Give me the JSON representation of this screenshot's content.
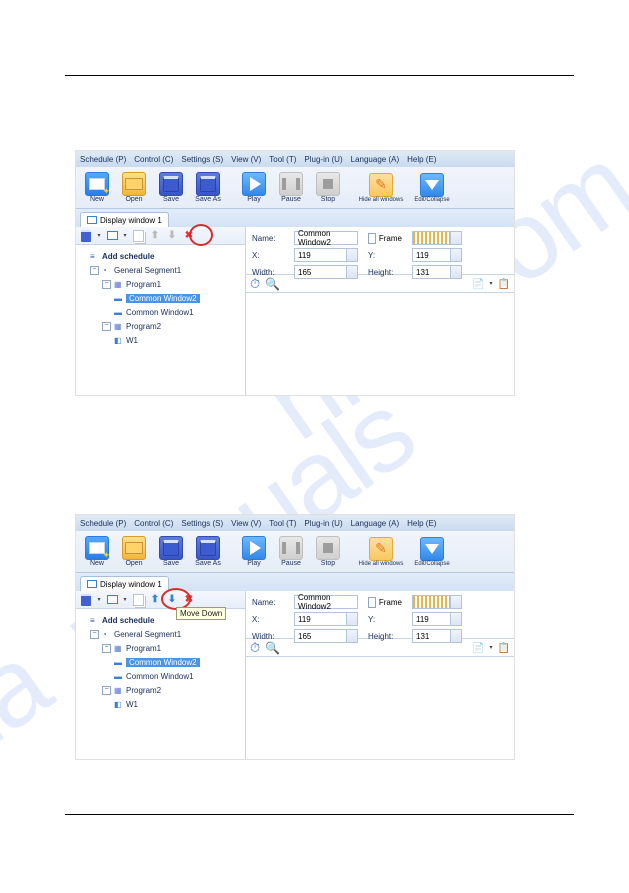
{
  "watermark": "manualshive.com",
  "menus": {
    "schedule": "Schedule (P)",
    "control": "Control (C)",
    "settings": "Settings (S)",
    "view": "View (V)",
    "tool": "Tool (T)",
    "plugin": "Plug-in (U)",
    "language": "Language (A)",
    "help": "Help (E)"
  },
  "toolbar": {
    "new": "New",
    "open": "Open",
    "save": "Save",
    "saveas": "Save As",
    "play": "Play",
    "pause": "Pause",
    "stop": "Stop",
    "hide": "Hide all windows",
    "collapse": "Edit/Collapse"
  },
  "tab": "Display window 1",
  "tree": {
    "root": "Add schedule",
    "seg": "General Segment1",
    "p1": "Program1",
    "cw2": "Common Window2",
    "cw1": "Common Window1",
    "p2": "Program2",
    "w1": "W1"
  },
  "props": {
    "name": "Name:",
    "name_val": "Common Window2",
    "x": "X:",
    "x_val": "119",
    "y": "Y:",
    "y_val": "119",
    "width": "Width:",
    "width_val": "165",
    "height": "Height:",
    "height_val": "131",
    "frame": "Frame"
  },
  "tooltip": "Move Down"
}
